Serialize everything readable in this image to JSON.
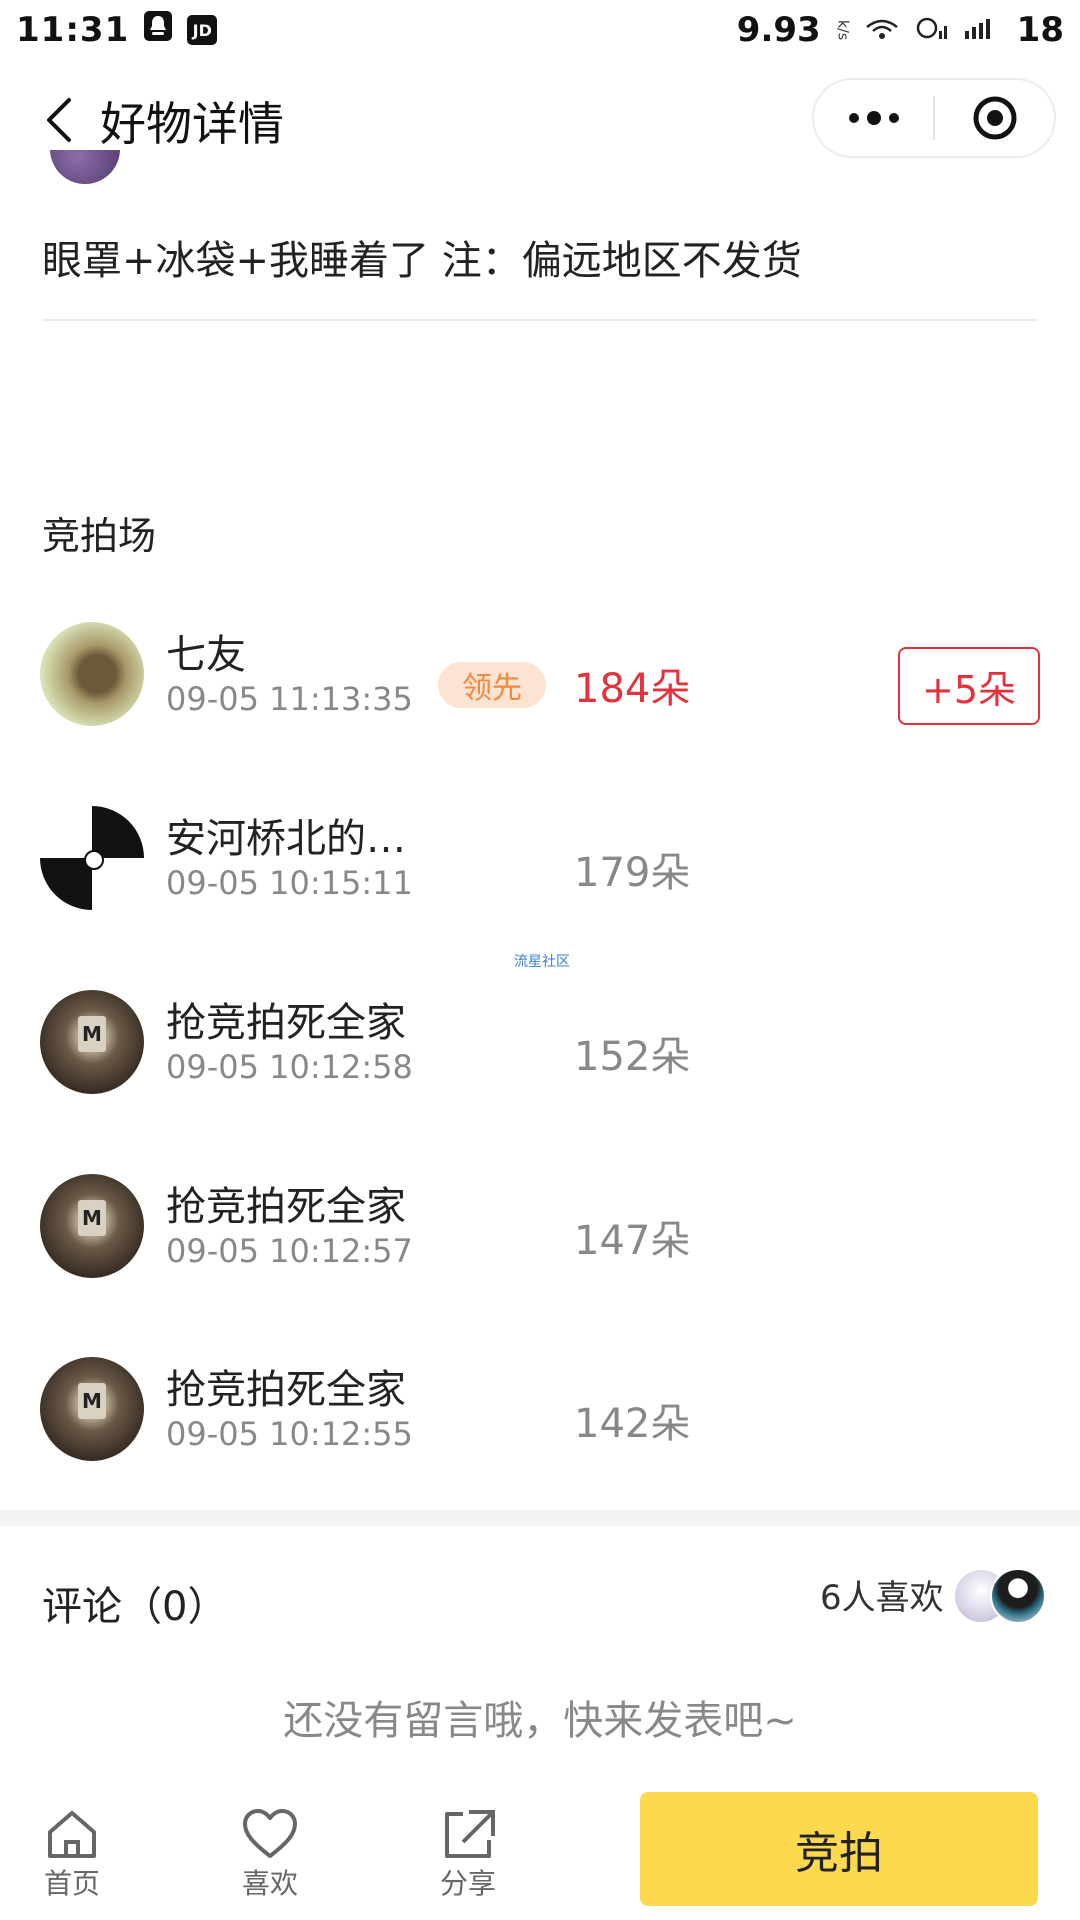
{
  "status_bar": {
    "time": "11:31",
    "left_icons": [
      "qq-icon",
      "jd-icon"
    ],
    "jd_label": "JD",
    "speed": "9.93",
    "speed_unit": "k/s",
    "battery": "18"
  },
  "nav": {
    "title": "好物详情"
  },
  "product": {
    "description": "眼罩+冰袋+我睡着了 注：偏远地区不发货"
  },
  "auction": {
    "section_title": "竞拍场",
    "lead_badge": "领先",
    "raise_button": "+5朵",
    "bids": [
      {
        "name": "七友",
        "time": "09-05 11:13:35",
        "amount": "184朵",
        "avatar": "green",
        "leading": true
      },
      {
        "name": "安河桥北的…",
        "time": "09-05 10:15:11",
        "amount": "179朵",
        "avatar": "bw",
        "leading": false
      },
      {
        "name": "抢竞拍死全家",
        "time": "09-05 10:12:58",
        "amount": "152朵",
        "avatar": "brown",
        "leading": false
      },
      {
        "name": "抢竞拍死全家",
        "time": "09-05 10:12:57",
        "amount": "147朵",
        "avatar": "brown",
        "leading": false
      },
      {
        "name": "抢竞拍死全家",
        "time": "09-05 10:12:55",
        "amount": "142朵",
        "avatar": "brown",
        "leading": false
      }
    ]
  },
  "watermark": "流星社区",
  "comments": {
    "title": "评论（0）",
    "likes": "6人喜欢",
    "empty": "还没有留言哦，快来发表吧~"
  },
  "tabbar": {
    "home": "首页",
    "like": "喜欢",
    "share": "分享",
    "bid": "竞拍"
  },
  "colors": {
    "accent_red": "#e2333c",
    "lead_badge_bg": "#fde4d2",
    "lead_badge_text": "#f08a3c",
    "bid_button": "#fdd94f"
  }
}
